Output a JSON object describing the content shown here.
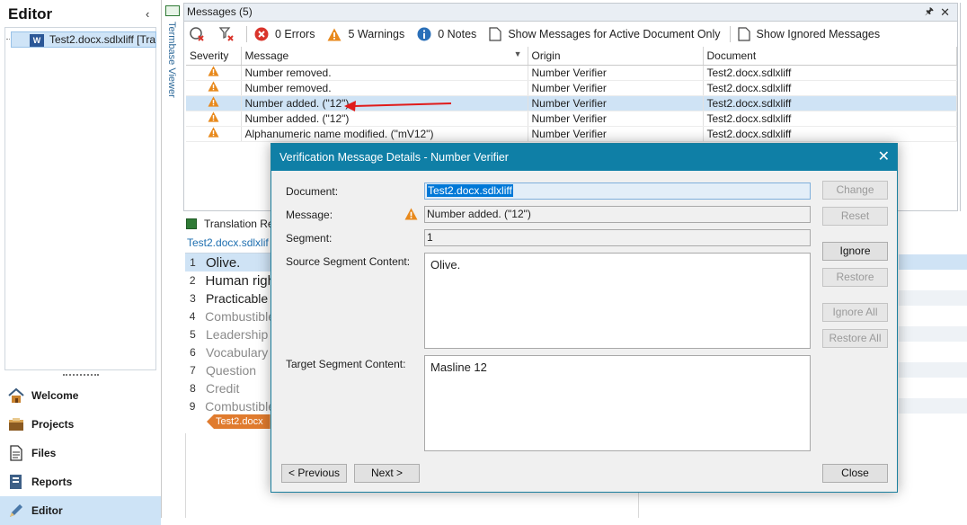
{
  "left_panel": {
    "title": "Editor",
    "tree_item": "Test2.docx.sdlxliff [Tran",
    "nav": [
      {
        "label": "Welcome",
        "icon": "home-icon"
      },
      {
        "label": "Projects",
        "icon": "projects-icon"
      },
      {
        "label": "Files",
        "icon": "files-icon"
      },
      {
        "label": "Reports",
        "icon": "reports-icon"
      },
      {
        "label": "Editor",
        "icon": "editor-icon"
      }
    ]
  },
  "termbase_tab": "Termbase Viewer",
  "messages": {
    "title": "Messages (5)",
    "toolbar": {
      "errors": "0 Errors",
      "warnings": "5 Warnings",
      "notes": "0 Notes",
      "active_only": "Show Messages for Active Document Only",
      "ignored": "Show Ignored Messages"
    },
    "columns": [
      "Severity",
      "Message",
      "Origin",
      "Document"
    ],
    "rows": [
      {
        "message": "Number removed.",
        "origin": "Number Verifier",
        "document": "Test2.docx.sdlxliff"
      },
      {
        "message": "Number removed.",
        "origin": "Number Verifier",
        "document": "Test2.docx.sdlxliff"
      },
      {
        "message": "Number added.  (\"12\")",
        "origin": "Number Verifier",
        "document": "Test2.docx.sdlxliff"
      },
      {
        "message": "Number added.  (\"12\")",
        "origin": "Number Verifier",
        "document": "Test2.docx.sdlxliff"
      },
      {
        "message": "Alphanumeric name modified. (\"mV12\")",
        "origin": "Number Verifier",
        "document": "Test2.docx.sdlxliff"
      }
    ],
    "selected_row": 2
  },
  "translation_results": {
    "title": "Translation Re",
    "doc_tab": "Test2.docx.sdlxlif",
    "segments": [
      {
        "num": "1",
        "text": "Olive."
      },
      {
        "num": "2",
        "text": "Human righ"
      },
      {
        "num": "3",
        "text": "Practicable f"
      },
      {
        "num": "4",
        "text": "Combustible"
      },
      {
        "num": "5",
        "text": "Leadership"
      },
      {
        "num": "6",
        "text": "Vocabulary"
      },
      {
        "num": "7",
        "text": "Question"
      },
      {
        "num": "8",
        "text": "Credit"
      },
      {
        "num": "9",
        "text": "Combustible"
      }
    ],
    "source_marker": "Test2.docx"
  },
  "dialog": {
    "title": "Verification Message Details - Number Verifier",
    "labels": {
      "document": "Document:",
      "message": "Message:",
      "segment": "Segment:",
      "source": "Source Segment Content:",
      "target": "Target Segment Content:"
    },
    "values": {
      "document": "Test2.docx.sdlxliff",
      "message": "Number added.  (\"12\")",
      "segment": "1",
      "source": "Olive.",
      "target": "Masline 12"
    },
    "buttons": {
      "change": "Change",
      "reset": "Reset",
      "ignore": "Ignore",
      "restore": "Restore",
      "ignore_all": "Ignore All",
      "restore_all": "Restore All",
      "previous": "< Previous",
      "next": "Next >",
      "close": "Close"
    }
  },
  "colors": {
    "dialog_titlebar": "#0f7fa6",
    "warning": "#e8891c",
    "error": "#d9342b",
    "selection": "#cfe3f5",
    "arrow": "#e01b1b"
  }
}
